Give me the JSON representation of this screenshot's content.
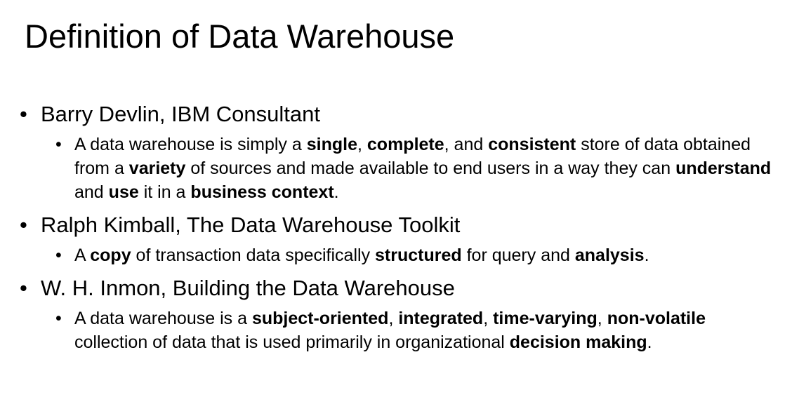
{
  "slide": {
    "title": "Definition of Data Warehouse",
    "definitions": [
      {
        "author": "Barry Devlin, IBM Consultant",
        "segments": [
          {
            "text": "A data warehouse is simply a ",
            "bold": false
          },
          {
            "text": "single",
            "bold": true
          },
          {
            "text": ", ",
            "bold": false
          },
          {
            "text": "complete",
            "bold": true
          },
          {
            "text": ", and ",
            "bold": false
          },
          {
            "text": "consistent",
            "bold": true
          },
          {
            "text": " store of data obtained from a ",
            "bold": false
          },
          {
            "text": "variety",
            "bold": true
          },
          {
            "text": " of sources and made available to end users in a way they can ",
            "bold": false
          },
          {
            "text": "understand",
            "bold": true
          },
          {
            "text": " and ",
            "bold": false
          },
          {
            "text": "use",
            "bold": true
          },
          {
            "text": " it in a ",
            "bold": false
          },
          {
            "text": "business context",
            "bold": true
          },
          {
            "text": ".",
            "bold": false
          }
        ]
      },
      {
        "author": "Ralph Kimball, The Data Warehouse Toolkit",
        "segments": [
          {
            "text": "A ",
            "bold": false
          },
          {
            "text": "copy",
            "bold": true
          },
          {
            "text": " of transaction data specifically ",
            "bold": false
          },
          {
            "text": "structured",
            "bold": true
          },
          {
            "text": " for query and ",
            "bold": false
          },
          {
            "text": "analysis",
            "bold": true
          },
          {
            "text": ".",
            "bold": false
          }
        ]
      },
      {
        "author": "W. H. Inmon, Building the Data Warehouse",
        "segments": [
          {
            "text": "A data warehouse is a ",
            "bold": false
          },
          {
            "text": "subject-oriented",
            "bold": true
          },
          {
            "text": ", ",
            "bold": false
          },
          {
            "text": "integrated",
            "bold": true
          },
          {
            "text": ", ",
            "bold": false
          },
          {
            "text": "time-varying",
            "bold": true
          },
          {
            "text": ", ",
            "bold": false
          },
          {
            "text": "non-volatile",
            "bold": true
          },
          {
            "text": " collection of data that is used primarily in organizational ",
            "bold": false
          },
          {
            "text": "decision making",
            "bold": true
          },
          {
            "text": ".",
            "bold": false
          }
        ]
      }
    ]
  }
}
